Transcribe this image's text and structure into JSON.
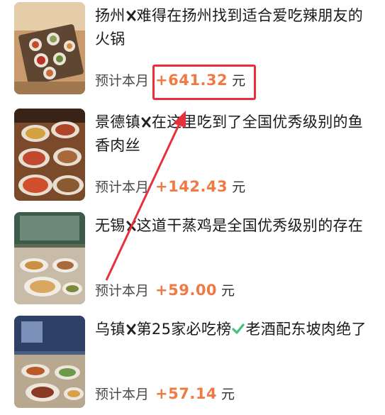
{
  "items": [
    {
      "city": "扬州",
      "text": "难得在扬州找到适合爱吃辣朋友的火锅",
      "earn_label": "预计本月",
      "earn_value": "+641.32",
      "earn_unit": "元"
    },
    {
      "city": "景德镇",
      "text": "在这里吃到了全国优秀级别的鱼香肉丝",
      "earn_label": "预计本月",
      "earn_value": "+142.43",
      "earn_unit": "元"
    },
    {
      "city": "无锡",
      "text": "这道干蒸鸡是全国优秀级别的存在",
      "earn_label": "预计本月",
      "earn_value": "+59.00",
      "earn_unit": "元"
    },
    {
      "city": "乌镇",
      "text_a": "第25家必吃榜",
      "text_b": "老酒配东坡肉绝了",
      "earn_label": "预计本月",
      "earn_value": "+57.14",
      "earn_unit": "元"
    }
  ],
  "colors": {
    "earn_value": "#f07a44",
    "highlight": "#e8303a",
    "check": "#46c07a",
    "cross": "#222222"
  },
  "icons": [
    "food-photo",
    "cross-mark-icon",
    "check-mark-icon",
    "red-arrow"
  ]
}
